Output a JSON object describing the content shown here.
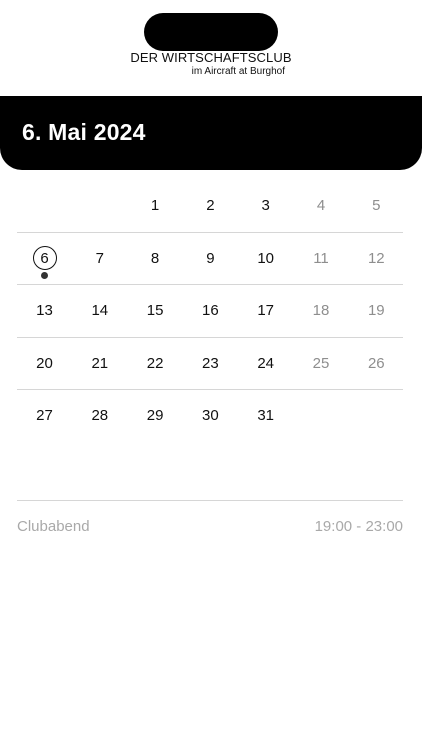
{
  "logo": {
    "line1": "DER WIRTSCHAFTSCLUB",
    "line2": "im Aircraft at Burghof"
  },
  "header": {
    "date": "6. Mai 2024"
  },
  "calendar": {
    "selected_day": "6",
    "weeks": [
      [
        "",
        "",
        "1",
        "2",
        "3",
        "4",
        "5"
      ],
      [
        "6",
        "7",
        "8",
        "9",
        "10",
        "11",
        "12"
      ],
      [
        "13",
        "14",
        "15",
        "16",
        "17",
        "18",
        "19"
      ],
      [
        "20",
        "21",
        "22",
        "23",
        "24",
        "25",
        "26"
      ],
      [
        "27",
        "28",
        "29",
        "30",
        "31",
        "",
        ""
      ]
    ],
    "event_days": [
      "6"
    ]
  },
  "event": {
    "title": "Clubabend",
    "time": "19:00 - 23:00"
  },
  "colors": {
    "header_bg": "#000000",
    "weekend_text": "#8e8e8e",
    "event_text": "#a9a9a9"
  }
}
